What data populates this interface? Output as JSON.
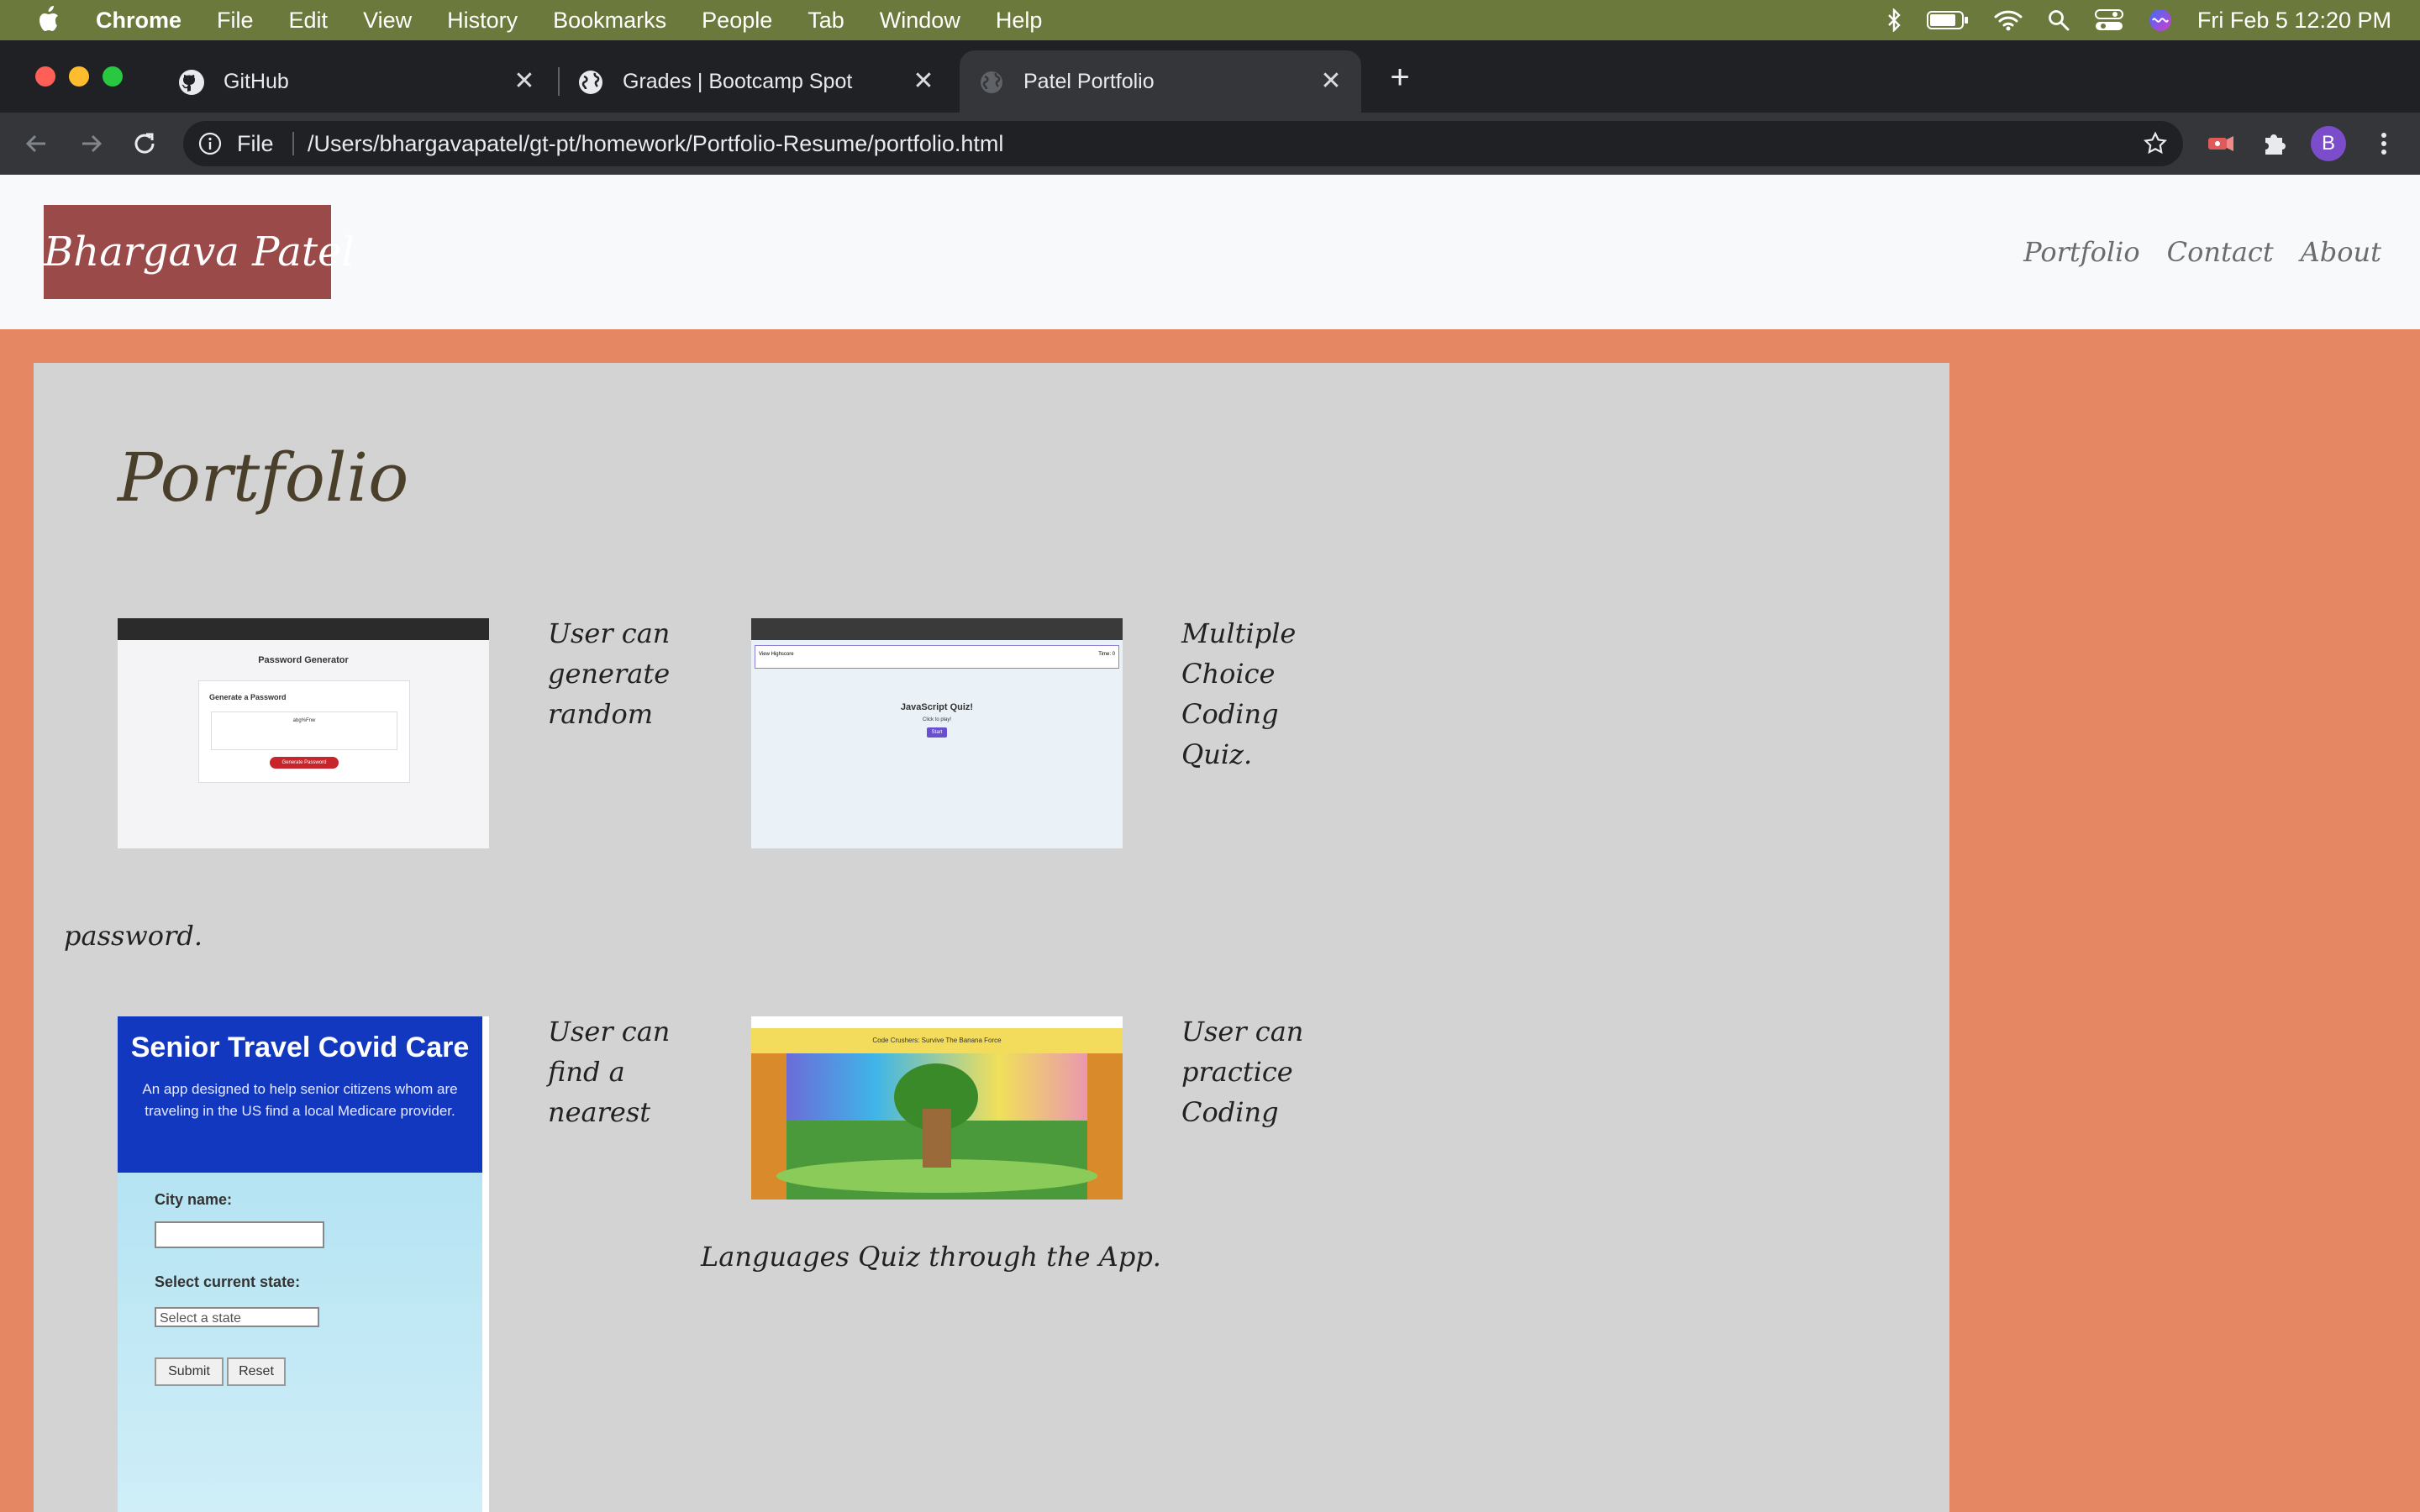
{
  "menubar": {
    "app_name": "Chrome",
    "menus": [
      "File",
      "Edit",
      "View",
      "History",
      "Bookmarks",
      "People",
      "Tab",
      "Window",
      "Help"
    ],
    "clock": "Fri Feb 5  12:20 PM"
  },
  "tabs": [
    {
      "title": "GitHub",
      "icon": "github-icon"
    },
    {
      "title": "Grades | Bootcamp Spot",
      "icon": "globe-icon"
    },
    {
      "title": "Patel Portfolio",
      "icon": "globe-icon",
      "active": true
    }
  ],
  "toolbar": {
    "scheme": "File",
    "url": "/Users/bhargavapatel/gt-pt/homework/Portfolio-Resume/portfolio.html",
    "profile_initial": "B"
  },
  "site": {
    "logo": "Bhargava Patel",
    "nav": [
      "Portfolio",
      "Contact",
      "About"
    ],
    "page_title": "Portfolio"
  },
  "projects": [
    {
      "desc_lines": [
        "User can",
        "generate",
        "random"
      ],
      "desc_tail": "password.",
      "thumb": {
        "heading": "Password Generator",
        "label": "Generate a Password",
        "value": "abg%Fnw",
        "button": "Generate Password"
      }
    },
    {
      "desc_lines": [
        "Multiple",
        "Choice",
        "Coding",
        "Quiz."
      ],
      "thumb": {
        "bar_left": "View Highscore",
        "bar_right": "Time: 0",
        "heading": "JavaScript Quiz!",
        "sub": "Click to play!",
        "button": "Start"
      }
    },
    {
      "desc_lines": [
        "User can",
        "find a",
        "nearest"
      ],
      "thumb": {
        "heading": "Senior Travel Covid Care",
        "para": "An app designed to help senior citizens whom are traveling in the US find a local Medicare provider.",
        "city_label": "City name:",
        "state_label": "Select current state:",
        "state_value": "Select a state",
        "submit": "Submit",
        "reset": "Reset"
      }
    },
    {
      "desc_lines": [
        "User can",
        "practice",
        "Coding"
      ],
      "desc_tail": "Languages Quiz through the App.",
      "thumb": {
        "banner": "Code Crushers: Survive The Banana Force"
      }
    }
  ],
  "colors": {
    "page_bg": "#e58762",
    "card_bg": "#d3d3d3",
    "logo_bg": "#9b4a4a",
    "header_bg": "#f8f9fa",
    "menubar_bg": "#6b7a3c"
  }
}
